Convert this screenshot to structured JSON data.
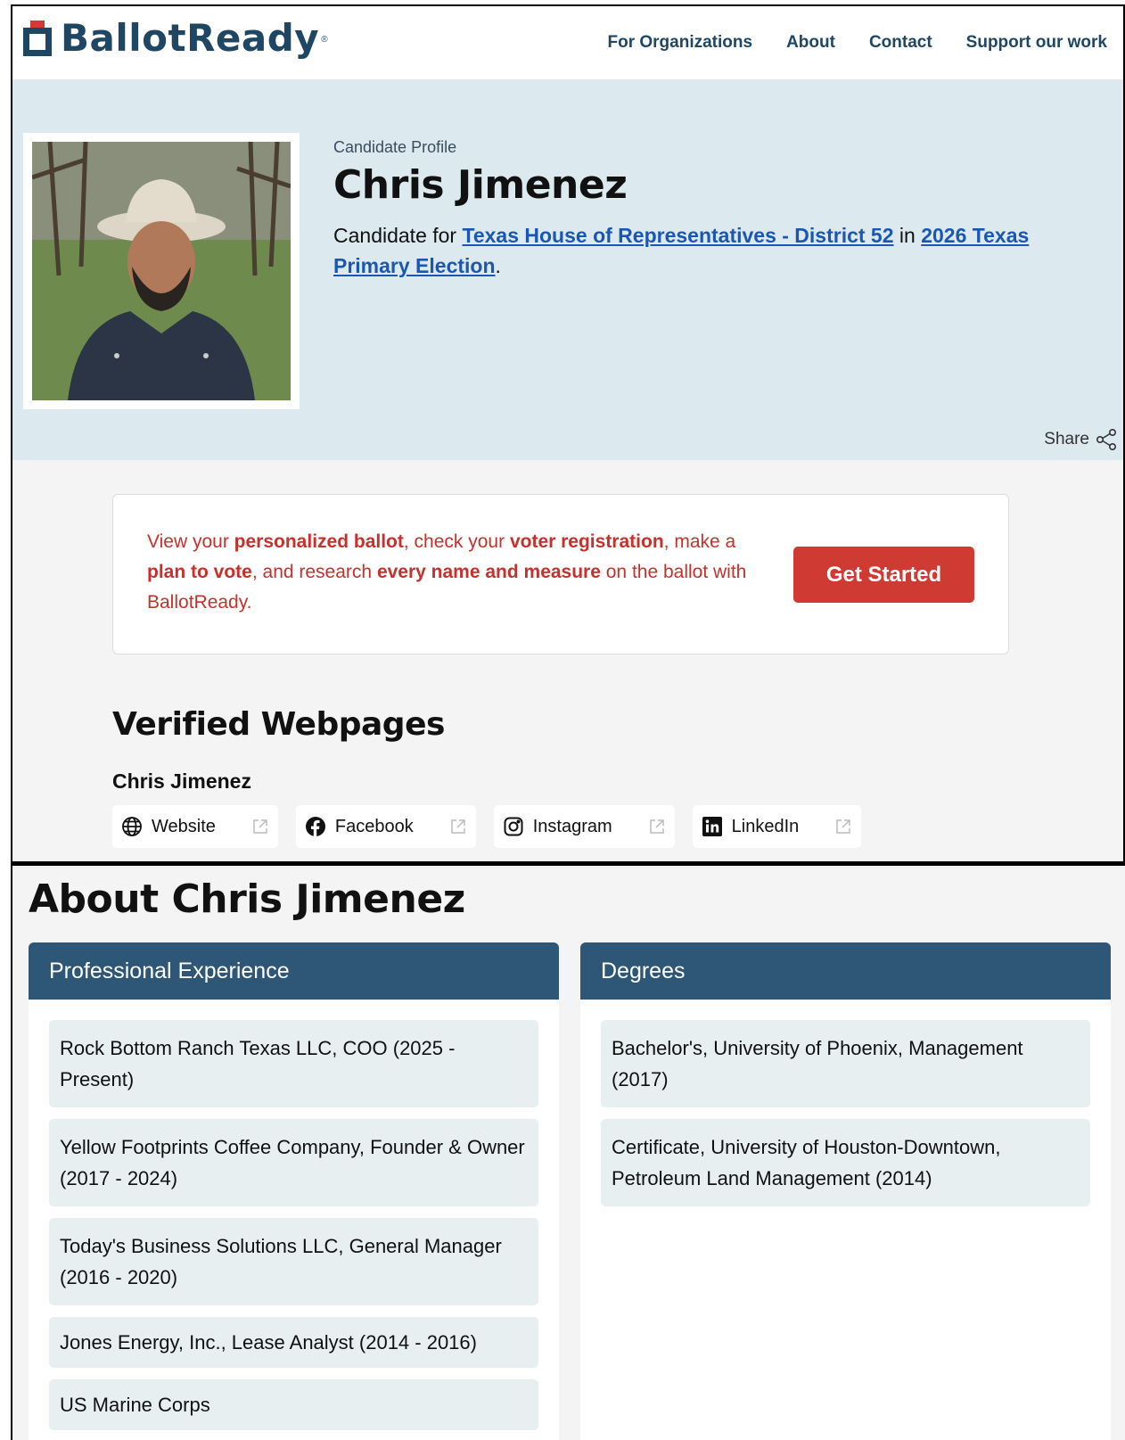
{
  "nav": {
    "logo": "BallotReady",
    "logo_reg": "®",
    "links": [
      "For Organizations",
      "About",
      "Contact",
      "Support our work"
    ]
  },
  "hero": {
    "eyebrow": "Candidate Profile",
    "name": "Chris Jimenez",
    "candidate_for_prefix": "Candidate for ",
    "office_link": "Texas House of Representatives - District 52",
    "in_text": " in ",
    "election_link": "2026 Texas Primary Election",
    "period": ".",
    "share": "Share"
  },
  "cta": {
    "t1": "View your ",
    "b1": "personalized ballot",
    "t2": ", check your ",
    "b2": "voter registration",
    "t3": ", make a ",
    "b3": "plan to vote",
    "t4": ", and research ",
    "b4": "every name and measure",
    "t5": " on the ballot with BallotReady.",
    "button": "Get Started"
  },
  "verified": {
    "title": "Verified Webpages",
    "subtitle": "Chris Jimenez",
    "links": [
      {
        "label": "Website",
        "icon": "globe-icon"
      },
      {
        "label": "Facebook",
        "icon": "facebook-icon"
      },
      {
        "label": "Instagram",
        "icon": "instagram-icon"
      },
      {
        "label": "LinkedIn",
        "icon": "linkedin-icon"
      }
    ]
  },
  "about": {
    "title": "About Chris Jimenez",
    "experience": {
      "heading": "Professional Experience",
      "items": [
        "Rock Bottom Ranch Texas LLC, COO (2025 - Present)",
        "Yellow Footprints Coffee Company, Founder & Owner (2017 - 2024)",
        "Today's Business Solutions LLC, General Manager (2016 - 2020)",
        "Jones Energy, Inc., Lease Analyst (2014 - 2016)",
        "US Marine Corps"
      ]
    },
    "degrees": {
      "heading": "Degrees",
      "items": [
        "Bachelor's, University of Phoenix, Management (2017)",
        "Certificate, University of Houston-Downtown, Petroleum Land Management (2014)"
      ]
    }
  },
  "colors": {
    "navy": "#1f4663",
    "panel_head": "#2e5676",
    "brand_red": "#cf3b33",
    "link_blue": "#1b57b1",
    "hero_bg": "#dce9ee"
  }
}
